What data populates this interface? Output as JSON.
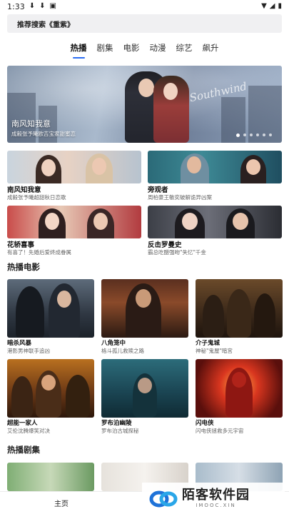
{
  "status_bar": {
    "time": "1:33",
    "left_icons": [
      "download-icon",
      "download-icon",
      "photo-icon"
    ],
    "right_icons": [
      "wifi-icon",
      "signal-icon",
      "battery-icon"
    ]
  },
  "search": {
    "text": "推荐搜索《重紫》"
  },
  "tabs": [
    {
      "label": "热播",
      "active": true
    },
    {
      "label": "剧集",
      "active": false
    },
    {
      "label": "电影",
      "active": false
    },
    {
      "label": "动漫",
      "active": false
    },
    {
      "label": "综艺",
      "active": false
    },
    {
      "label": "飙升",
      "active": false
    }
  ],
  "banner": {
    "title": "南风知我意",
    "subtitle": "成毅张予曦欧吉宝家甜蜜恋",
    "script_text": "Southwind",
    "dot_count": 6,
    "active_dot": 0
  },
  "featured": [
    {
      "name": "南风知我意",
      "desc": "成毅张予曦超甜秋日恋歌"
    },
    {
      "name": "旁观者",
      "desc": "周柏豪王敏奕破解诡异凶案"
    },
    {
      "name": "花轿喜事",
      "desc": "有喜了！先婚后爱终成眷属"
    },
    {
      "name": "反击罗曼史",
      "desc": "霸总吃醋强吻\"失忆\"千金"
    }
  ],
  "movies_section": {
    "title": "热播电影"
  },
  "movies": [
    {
      "name": "暗杀风暴",
      "desc": "港影男神联手追凶"
    },
    {
      "name": "八角笼中",
      "desc": "格斗孤儿救赎之路"
    },
    {
      "name": "介子鬼城",
      "desc": "神秘\"鬼屋\"暗宫"
    },
    {
      "name": "超能一家人",
      "desc": "艾伦沈腾爆笑对决"
    },
    {
      "name": "罗布泊幽陵",
      "desc": "罗布泊古城探秘"
    },
    {
      "name": "闪电侠",
      "desc": "闪电侠拯救多元宇宙"
    }
  ],
  "series_section": {
    "title": "热播剧集"
  },
  "bottom_nav": {
    "home_label": "主页"
  },
  "watermark": {
    "brand": "陌客软件园",
    "domain": "IMOOC.XIN"
  }
}
